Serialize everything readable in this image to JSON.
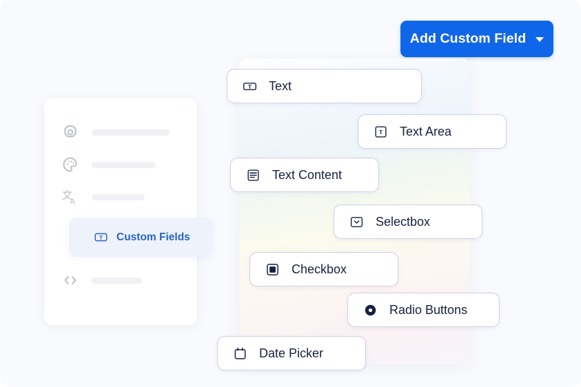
{
  "header": {
    "add_button_label": "Add Custom Field",
    "add_button_icon": "chevron-down-icon",
    "accent_color": "#1066e8"
  },
  "sidebar": {
    "items": [
      {
        "icon": "gear-icon",
        "label": "",
        "active": false
      },
      {
        "icon": "palette-icon",
        "label": "",
        "active": false
      },
      {
        "icon": "translate-icon",
        "label": "",
        "active": false
      },
      {
        "icon": "code-icon",
        "label": "",
        "active": false
      }
    ],
    "active_item": {
      "icon": "text-field-icon",
      "label": "Custom Fields",
      "color": "#2864c8",
      "background": "#eef2fb"
    }
  },
  "fields": {
    "cards": [
      {
        "label": "Text",
        "icon": "text-field-icon"
      },
      {
        "label": "Text Area",
        "icon": "text-area-icon"
      },
      {
        "label": "Text Content",
        "icon": "text-content-icon"
      },
      {
        "label": "Selectbox",
        "icon": "selectbox-icon"
      },
      {
        "label": "Checkbox",
        "icon": "checkbox-icon"
      },
      {
        "label": "Radio Buttons",
        "icon": "radio-button-icon"
      },
      {
        "label": "Date Picker",
        "icon": "calendar-icon"
      }
    ],
    "card_border_color": "#cfcee8",
    "card_text_color": "#162040"
  },
  "canvas": {
    "background_color": "#f8fafd"
  }
}
